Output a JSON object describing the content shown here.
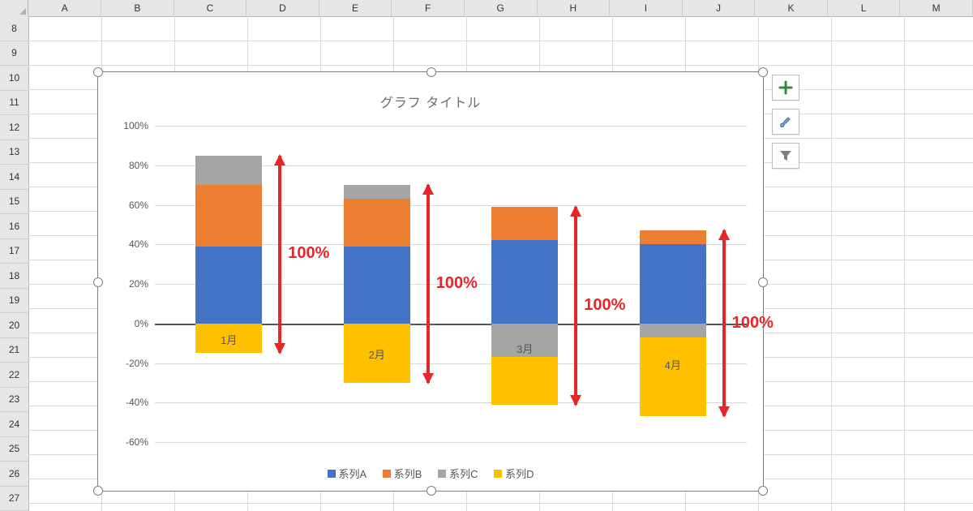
{
  "columns": [
    "A",
    "B",
    "C",
    "D",
    "E",
    "F",
    "G",
    "H",
    "I",
    "J",
    "K",
    "L",
    "M"
  ],
  "row_start": 8,
  "row_count": 20,
  "chart": {
    "title": "グラフ タイトル"
  },
  "legend": {
    "a": "系列A",
    "b": "系列B",
    "c": "系列C",
    "d": "系列D"
  },
  "annotation_label": "100%",
  "tools": {
    "add": "chart-elements-button",
    "style": "chart-styles-button",
    "filter": "chart-filter-button"
  },
  "chart_data": {
    "type": "bar",
    "stacked": true,
    "title": "グラフ タイトル",
    "xlabel": "",
    "ylabel": "",
    "ylim": [
      -60,
      100
    ],
    "yticks": [
      -60,
      -40,
      -20,
      0,
      20,
      40,
      60,
      80,
      100
    ],
    "ytick_labels": [
      "-60%",
      "-40%",
      "-20%",
      "0%",
      "20%",
      "40%",
      "60%",
      "80%",
      "100%"
    ],
    "categories": [
      "1月",
      "2月",
      "3月",
      "4月"
    ],
    "series": [
      {
        "name": "系列A",
        "color": "#4472C4",
        "values": [
          39,
          39,
          42,
          40
        ]
      },
      {
        "name": "系列B",
        "color": "#ED7D31",
        "values": [
          31,
          24,
          17,
          7
        ]
      },
      {
        "name": "系列C",
        "color": "#A5A5A5",
        "values": [
          15,
          7,
          -17,
          -7
        ]
      },
      {
        "name": "系列D",
        "color": "#FFC000",
        "values": [
          -15,
          -30,
          -24,
          -40
        ]
      }
    ],
    "annotations": [
      {
        "text": "100%",
        "category": "1月"
      },
      {
        "text": "100%",
        "category": "2月"
      },
      {
        "text": "100%",
        "category": "3月"
      },
      {
        "text": "100%",
        "category": "4月"
      }
    ]
  }
}
